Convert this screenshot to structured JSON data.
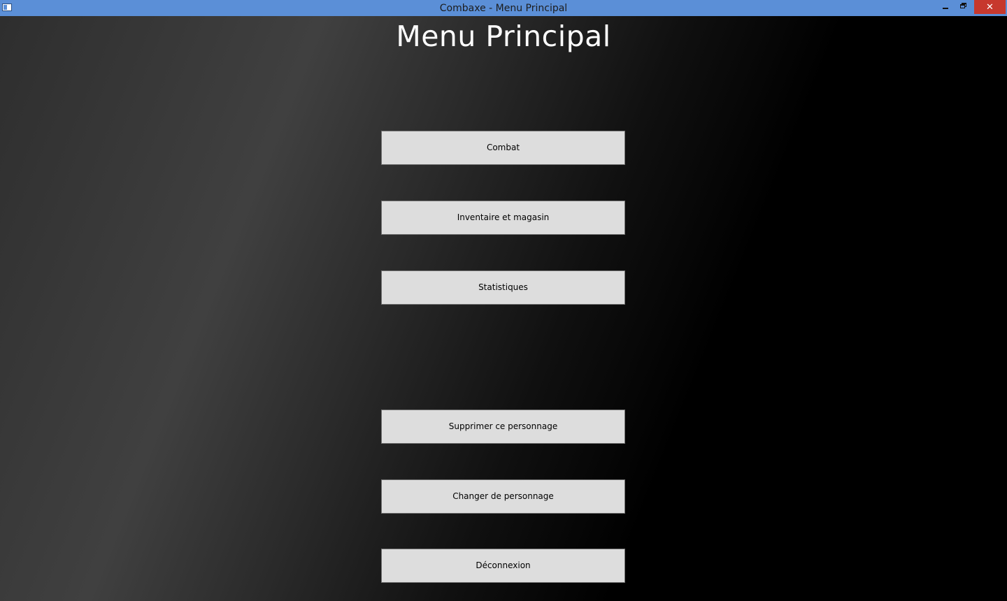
{
  "window": {
    "title": "Combaxe - Menu Principal",
    "controls": {
      "minimize_icon": "minimize-icon",
      "maximize_icon": "restore-icon",
      "close_label": "✕"
    },
    "titlebar_color": "#5b8fd7",
    "close_color": "#c7382d"
  },
  "main": {
    "title": "Menu Principal",
    "buttons": [
      {
        "label": "Combat"
      },
      {
        "label": "Inventaire et magasin"
      },
      {
        "label": "Statistiques"
      },
      {
        "label": "Supprimer ce personnage"
      },
      {
        "label": "Changer de personnage"
      },
      {
        "label": "Déconnexion"
      }
    ]
  }
}
